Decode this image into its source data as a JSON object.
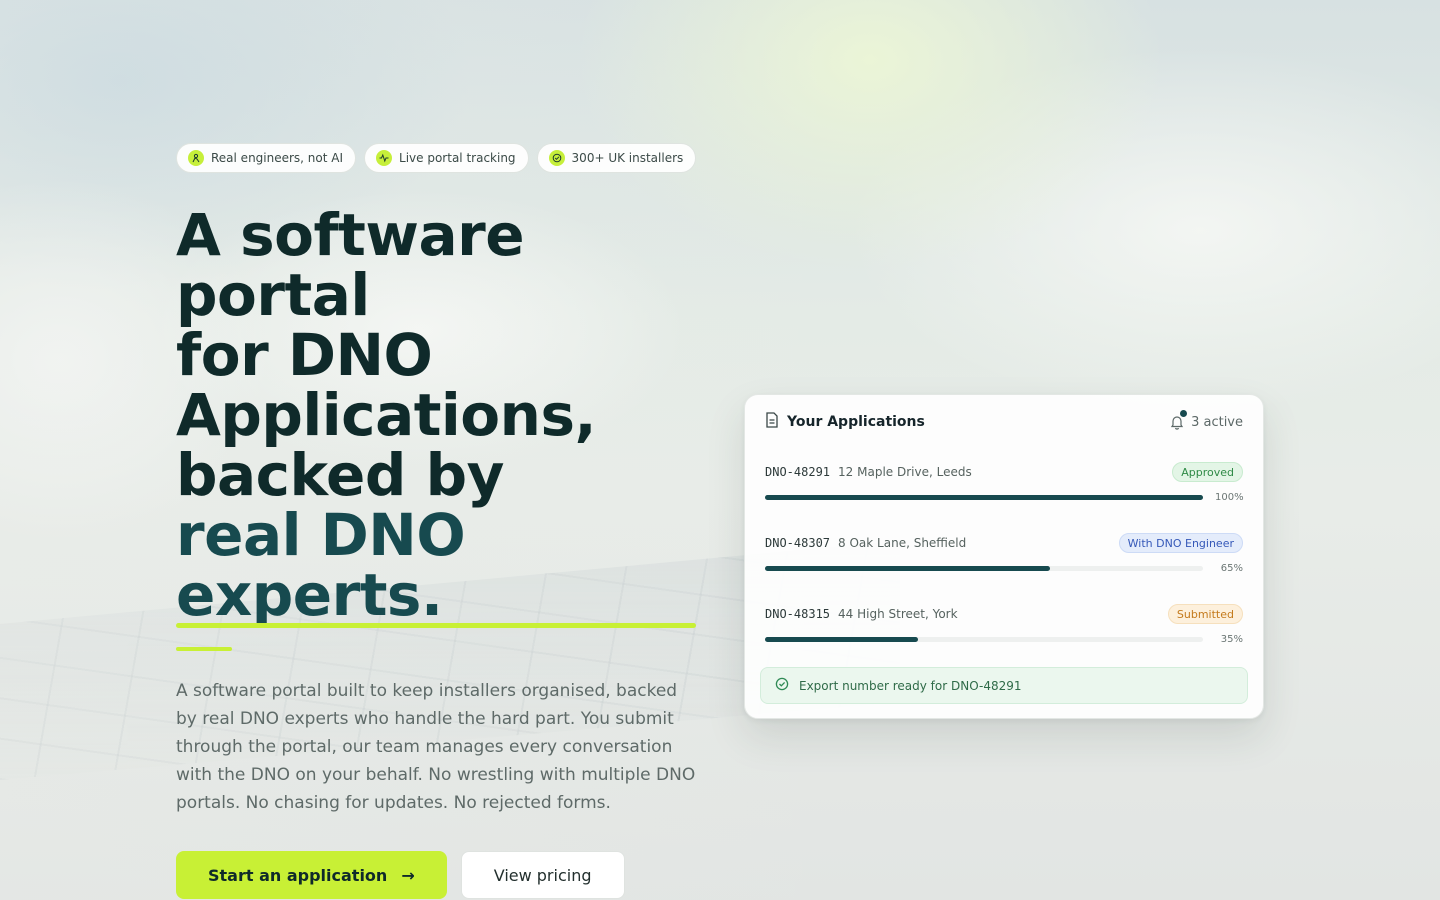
{
  "chips": [
    {
      "label": "Real engineers, not AI",
      "icon": "engineer-icon"
    },
    {
      "label": "Live portal tracking",
      "icon": "activity-icon"
    },
    {
      "label": "300+ UK installers",
      "icon": "check-circle-icon"
    }
  ],
  "hero": {
    "headline_lines": [
      "A software",
      "portal",
      "for DNO",
      "Applications,",
      "backed by"
    ],
    "accent_lines": [
      "real DNO",
      "experts."
    ],
    "lead": "A software portal built to keep installers organised, backed by real DNO experts who handle the hard part. You submit through the portal, our team manages every conversation with the DNO on your behalf. No wrestling with multiple DNO portals. No chasing for updates. No rejected forms."
  },
  "ctas": {
    "primary_label": "Start an application",
    "primary_arrow": "→",
    "secondary_label": "View pricing"
  },
  "card": {
    "title": "Your Applications",
    "active_label": "3 active",
    "applications": [
      {
        "id": "DNO-48291",
        "address": "12 Maple Drive, Leeds",
        "status": "Approved",
        "progress": 100,
        "progress_label": "100%"
      },
      {
        "id": "DNO-48307",
        "address": "8 Oak Lane, Sheffield",
        "status": "With DNO Engineer",
        "progress": 65,
        "progress_label": "65%"
      },
      {
        "id": "DNO-48315",
        "address": "44 High Street, York",
        "status": "Submitted",
        "progress": 35,
        "progress_label": "35%"
      }
    ],
    "notice": "Export number ready for DNO-48291"
  },
  "colors": {
    "accent_lime": "#c8f035",
    "brand_teal": "#174a4f",
    "headline": "#0f2a2a"
  }
}
